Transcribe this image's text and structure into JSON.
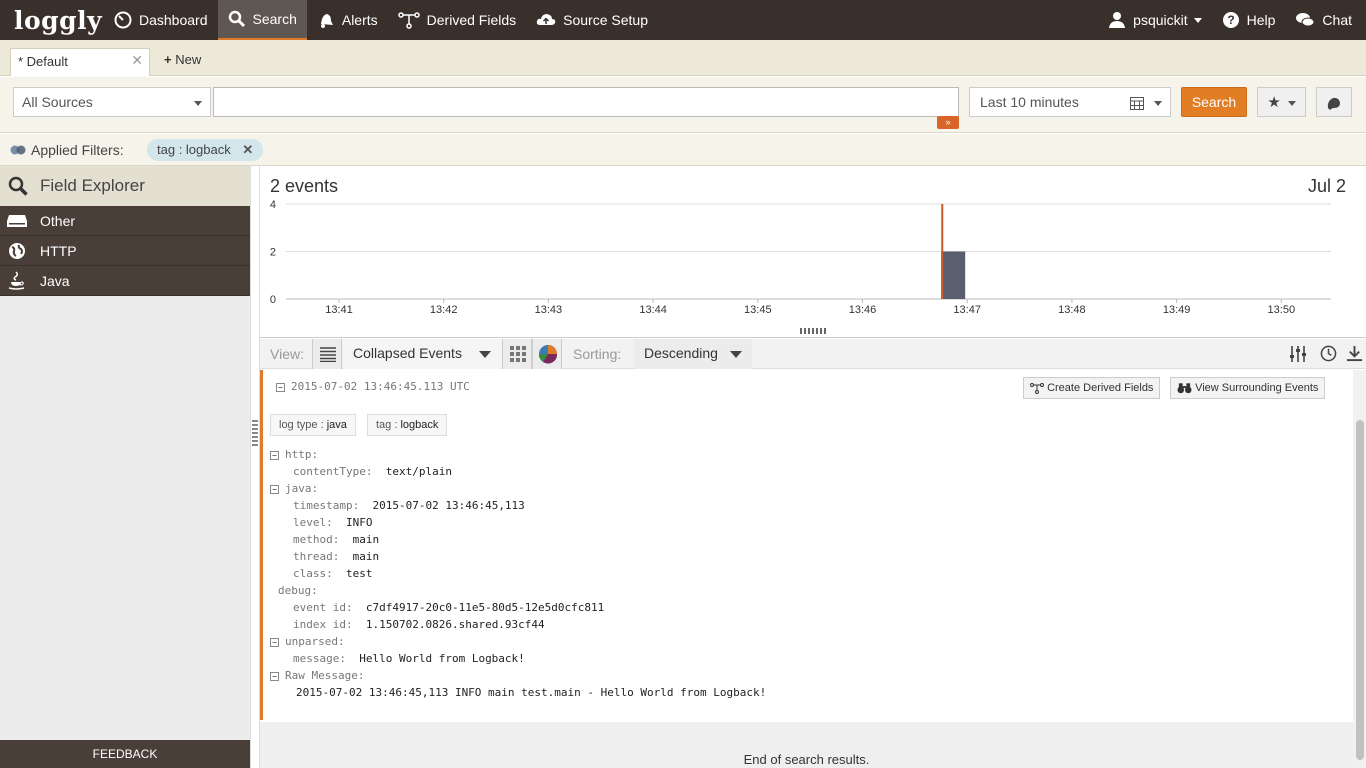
{
  "app": {
    "logo": "loggly"
  },
  "nav": {
    "items": [
      {
        "label": "Dashboard",
        "icon": "dashboard-icon"
      },
      {
        "label": "Search",
        "icon": "search-icon",
        "active": true
      },
      {
        "label": "Alerts",
        "icon": "bell-icon"
      },
      {
        "label": "Derived Fields",
        "icon": "branch-icon"
      },
      {
        "label": "Source Setup",
        "icon": "cloud-upload-icon"
      }
    ],
    "user": "psquickit",
    "help": "Help",
    "chat": "Chat"
  },
  "tabs": {
    "current": "* Default",
    "new": "New"
  },
  "search": {
    "sources": "All Sources",
    "query": "",
    "time_range": "Last 10 minutes",
    "button": "Search"
  },
  "filters": {
    "label": "Applied Filters:",
    "chip_key": "tag",
    "chip_value": "logback"
  },
  "sidebar": {
    "title": "Field Explorer",
    "items": [
      {
        "label": "Other",
        "icon": "drive-icon"
      },
      {
        "label": "HTTP",
        "icon": "globe-icon"
      },
      {
        "label": "Java",
        "icon": "java-cup-icon"
      }
    ],
    "feedback": "FEEDBACK"
  },
  "chart": {
    "count": "2 events",
    "date": "Jul 2"
  },
  "chart_data": {
    "type": "bar",
    "title": "2 events",
    "categories": [
      "13:41",
      "13:42",
      "13:43",
      "13:44",
      "13:45",
      "13:46",
      "13:47",
      "13:48",
      "13:49",
      "13:50"
    ],
    "values": [
      0,
      0,
      0,
      0,
      0,
      0,
      2,
      0,
      0,
      0
    ],
    "ylim": [
      0,
      4
    ],
    "yticks": [
      0,
      2,
      4
    ],
    "marker_at": "13:46.8",
    "grid": true,
    "bar_color": "#5a5f70",
    "marker_color": "#c85a1f"
  },
  "viewbar": {
    "view_label": "View:",
    "view_mode": "Collapsed Events",
    "sorting_label": "Sorting:",
    "sort": "Descending"
  },
  "event": {
    "timestamp": "2015-07-02 13:46:45.113 UTC",
    "create_derived": "Create Derived Fields",
    "surrounding": "View Surrounding Events",
    "pills": [
      {
        "k": "log type",
        "v": "java"
      },
      {
        "k": "tag",
        "v": "logback"
      }
    ],
    "lines": [
      {
        "type": "section",
        "text": "http:"
      },
      {
        "type": "kv",
        "k": "contentType:",
        "v": "text/plain"
      },
      {
        "type": "section",
        "text": "java:"
      },
      {
        "type": "kv",
        "k": "timestamp:",
        "v": "2015-07-02 13:46:45,113"
      },
      {
        "type": "kv",
        "k": "level:",
        "v": "INFO"
      },
      {
        "type": "kv",
        "k": "method:",
        "v": "main"
      },
      {
        "type": "kv",
        "k": "thread:",
        "v": "main"
      },
      {
        "type": "kv",
        "k": "class:",
        "v": "test"
      },
      {
        "type": "plain",
        "text": "debug:"
      },
      {
        "type": "kv",
        "k": "event id:",
        "v": "c7df4917-20c0-11e5-80d5-12e5d0cfc811"
      },
      {
        "type": "kv",
        "k": "index id:",
        "v": "1.150702.0826.shared.93cf44"
      },
      {
        "type": "section",
        "text": "unparsed:"
      },
      {
        "type": "kv",
        "k": "message:",
        "v": "Hello World from Logback!"
      },
      {
        "type": "section",
        "text": "Raw Message:"
      },
      {
        "type": "raw",
        "text": "2015-07-02 13:46:45,113 INFO main test.main - Hello World from Logback!"
      }
    ],
    "end_text": "End of search results."
  }
}
